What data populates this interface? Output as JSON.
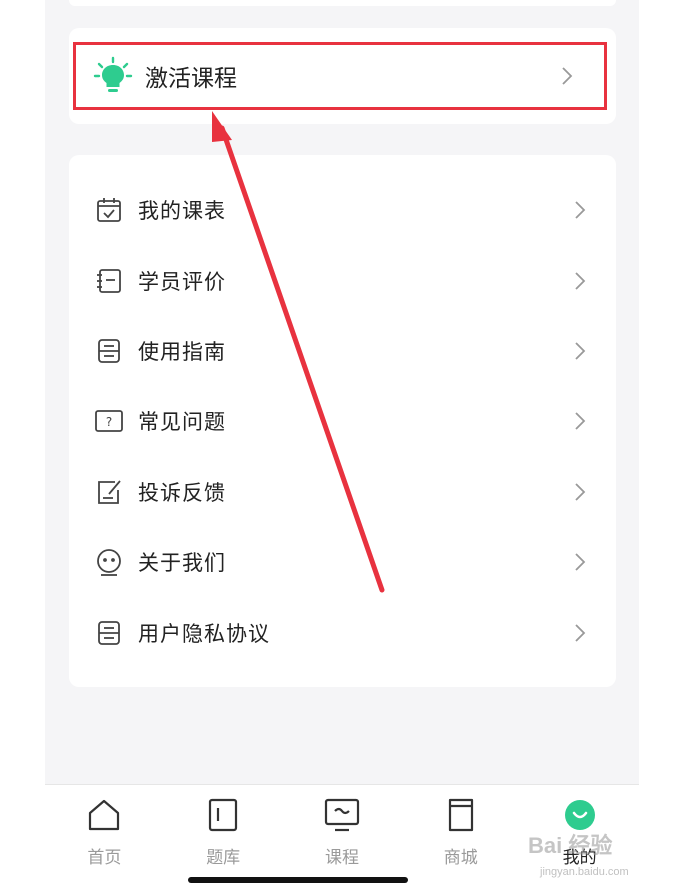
{
  "activate": {
    "label": "激活课程",
    "icon": "lightbulb-icon",
    "accent": "#2ecc8f"
  },
  "highlight_color": "#e8323f",
  "menu": {
    "items": [
      {
        "label": "我的课表",
        "icon": "calendar-check-icon"
      },
      {
        "label": "学员评价",
        "icon": "notebook-icon"
      },
      {
        "label": "使用指南",
        "icon": "guide-icon"
      },
      {
        "label": "常见问题",
        "icon": "question-box-icon"
      },
      {
        "label": "投诉反馈",
        "icon": "edit-feedback-icon"
      },
      {
        "label": "关于我们",
        "icon": "smiley-icon"
      },
      {
        "label": "用户隐私协议",
        "icon": "document-icon"
      }
    ]
  },
  "tabbar": {
    "items": [
      {
        "label": "首页",
        "icon": "home-icon"
      },
      {
        "label": "题库",
        "icon": "question-bank-icon"
      },
      {
        "label": "课程",
        "icon": "monitor-icon"
      },
      {
        "label": "商城",
        "icon": "store-icon"
      },
      {
        "label": "我的",
        "icon": "profile-icon",
        "active": true
      }
    ]
  },
  "watermark": {
    "text": "Bai 经验",
    "sub": "jingyan.baidu.com"
  }
}
